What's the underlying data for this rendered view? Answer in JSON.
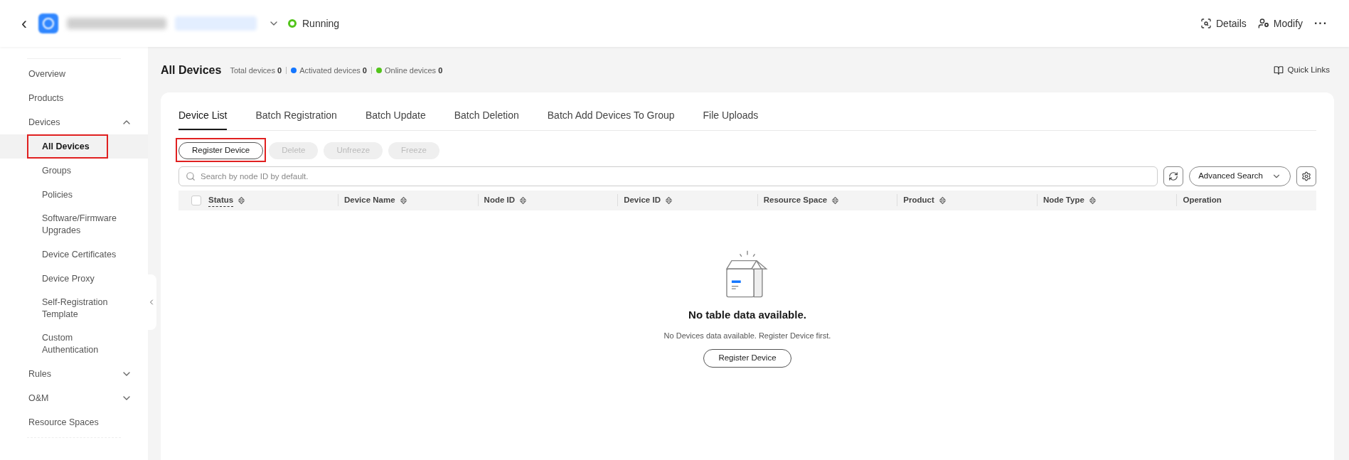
{
  "header": {
    "back": "‹",
    "status": {
      "label": "Running",
      "color": "#52c41a"
    },
    "actions": [
      {
        "kind": "details",
        "label": "Details"
      },
      {
        "kind": "modify",
        "label": "Modify"
      },
      {
        "kind": "more",
        "label": "···"
      }
    ]
  },
  "sidebar": {
    "items": [
      {
        "label": "Overview",
        "selected": false,
        "highlighted": false
      },
      {
        "label": "Products",
        "selected": false,
        "highlighted": false
      },
      {
        "label": "Devices",
        "selected": false,
        "highlighted": false,
        "expanded": true,
        "children": [
          {
            "label": "All Devices",
            "selected": true,
            "highlighted": true
          },
          {
            "label": "Groups",
            "selected": false,
            "highlighted": false
          },
          {
            "label": "Policies",
            "selected": false,
            "highlighted": false
          },
          {
            "label": "Software/Firmware Upgrades",
            "selected": false,
            "highlighted": false
          },
          {
            "label": "Device Certificates",
            "selected": false,
            "highlighted": false
          },
          {
            "label": "Device Proxy",
            "selected": false,
            "highlighted": false
          },
          {
            "label": "Self-Registration Template",
            "selected": false,
            "highlighted": false
          },
          {
            "label": "Custom Authentication",
            "selected": false,
            "highlighted": false
          }
        ]
      },
      {
        "label": "Rules",
        "selected": false,
        "highlighted": false,
        "expanded": false
      },
      {
        "label": "O&M",
        "selected": false,
        "highlighted": false,
        "expanded": false
      },
      {
        "label": "Resource Spaces",
        "selected": false,
        "highlighted": false
      }
    ]
  },
  "page": {
    "title": "All Devices",
    "stats": [
      {
        "label": "Total devices",
        "value": "0"
      },
      {
        "label": "Activated devices",
        "value": "0",
        "color": "#1476ff"
      },
      {
        "label": "Online devices",
        "value": "0",
        "color": "#52c41a"
      }
    ],
    "quick_links": "Quick Links"
  },
  "tabs": [
    {
      "label": "Device List",
      "selected": true
    },
    {
      "label": "Batch Registration",
      "selected": false
    },
    {
      "label": "Batch Update",
      "selected": false
    },
    {
      "label": "Batch Deletion",
      "selected": false
    },
    {
      "label": "Batch Add Devices To Group",
      "selected": false
    },
    {
      "label": "File Uploads",
      "selected": false
    }
  ],
  "toolbar": [
    {
      "label": "Register Device",
      "disabled": false,
      "highlighted": true
    },
    {
      "label": "Delete",
      "disabled": true,
      "highlighted": false
    },
    {
      "label": "Unfreeze",
      "disabled": true,
      "highlighted": false
    },
    {
      "label": "Freeze",
      "disabled": true,
      "highlighted": false
    }
  ],
  "search": {
    "placeholder": "Search by node ID by default.",
    "advanced": "Advanced Search"
  },
  "table": {
    "select_all_checked": false,
    "columns": [
      {
        "label": "Status",
        "sortable": true
      },
      {
        "label": "Device Name",
        "sortable": true
      },
      {
        "label": "Node ID",
        "sortable": true
      },
      {
        "label": "Device ID",
        "sortable": true
      },
      {
        "label": "Resource Space",
        "sortable": true
      },
      {
        "label": "Product",
        "sortable": true
      },
      {
        "label": "Node Type",
        "sortable": true
      },
      {
        "label": "Operation",
        "sortable": false
      }
    ]
  },
  "empty": {
    "title": "No table data available.",
    "message": "No Devices data available. Register Device first.",
    "button": "Register Device"
  }
}
